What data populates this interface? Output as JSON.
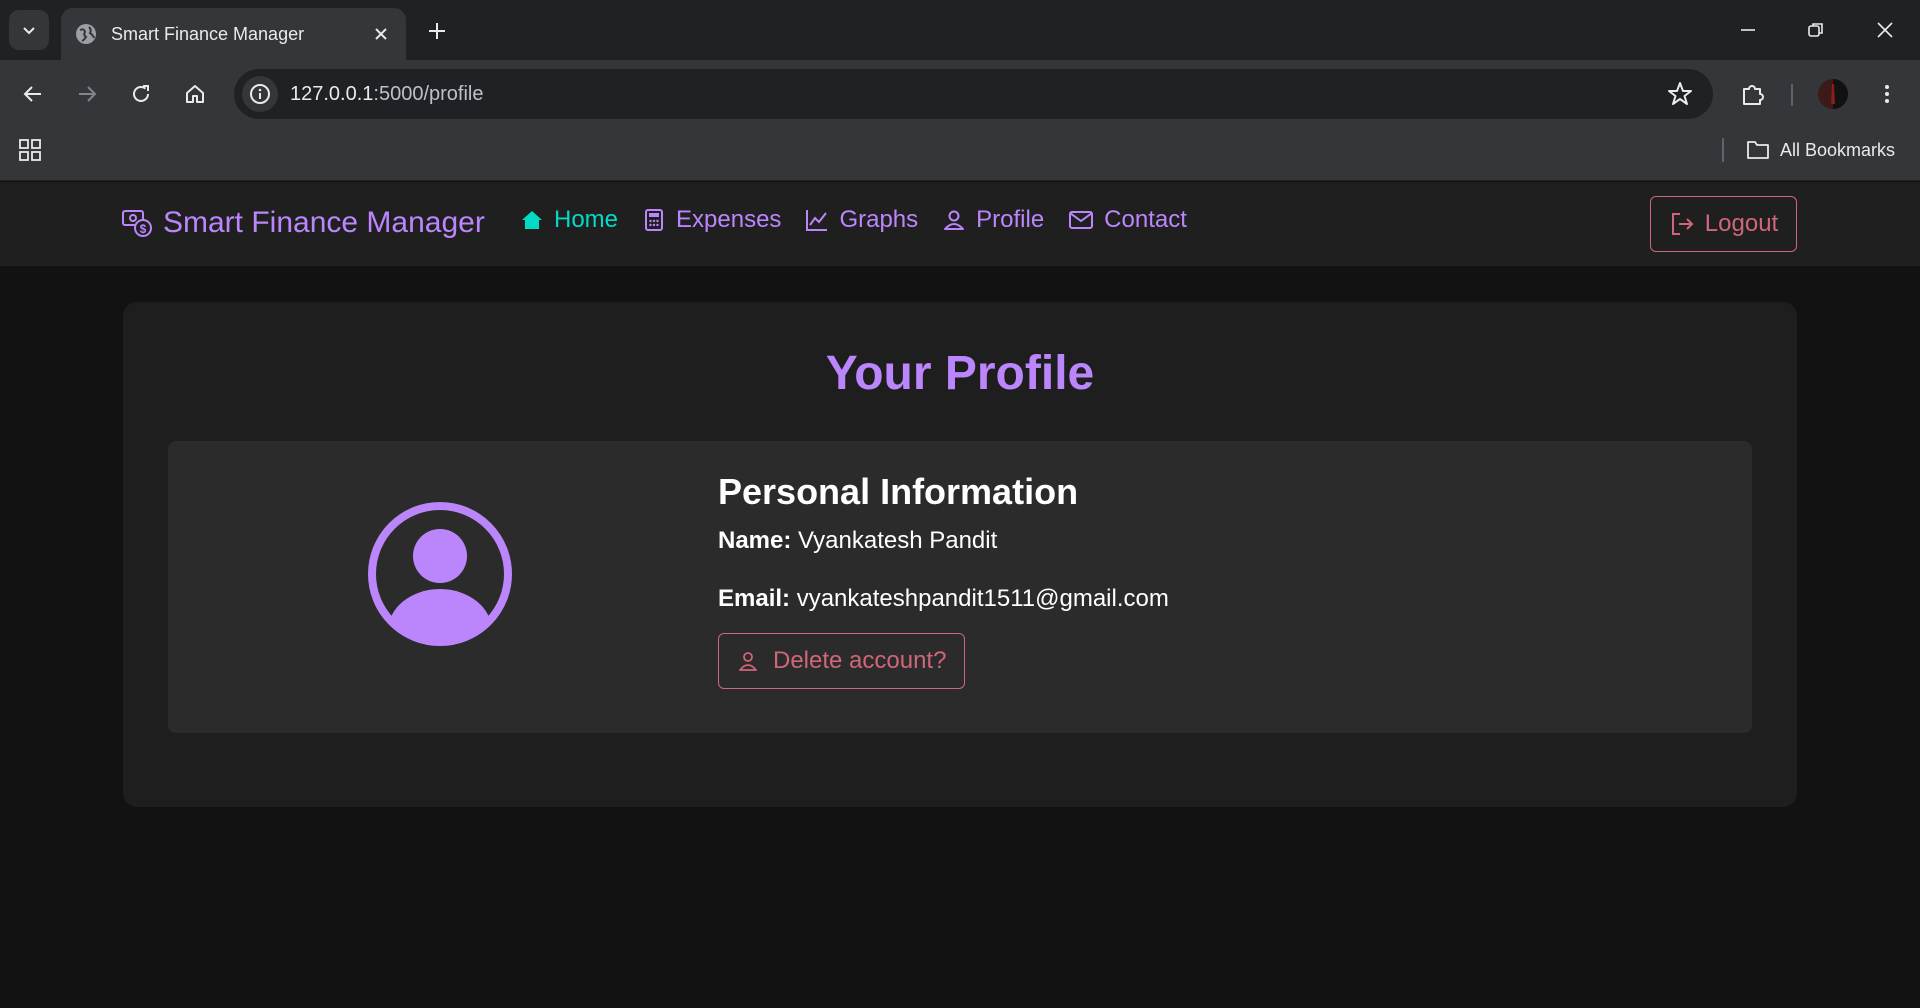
{
  "browser": {
    "tab_title": "Smart Finance Manager",
    "url_host": "127.0.0.1",
    "url_path": ":5000/profile",
    "bookmarks_label": "All Bookmarks"
  },
  "app": {
    "brand": "Smart Finance Manager",
    "nav": [
      {
        "label": "Home",
        "icon": "house-icon",
        "active": true
      },
      {
        "label": "Expenses",
        "icon": "calculator-icon"
      },
      {
        "label": "Graphs",
        "icon": "graph-icon"
      },
      {
        "label": "Profile",
        "icon": "person-icon"
      },
      {
        "label": "Contact",
        "icon": "envelope-icon"
      }
    ],
    "logout_label": "Logout",
    "colors": {
      "accent": "#bb86fc",
      "active": "#03dac6",
      "danger": "#cf6679",
      "background": "#121212"
    }
  },
  "profile": {
    "title": "Your Profile",
    "section_title": "Personal Information",
    "name_label": "Name:",
    "name_value": "Vyankatesh Pandit",
    "email_label": "Email:",
    "email_value": "vyankateshpandit1511@gmail.com",
    "delete_label": "Delete account?"
  }
}
